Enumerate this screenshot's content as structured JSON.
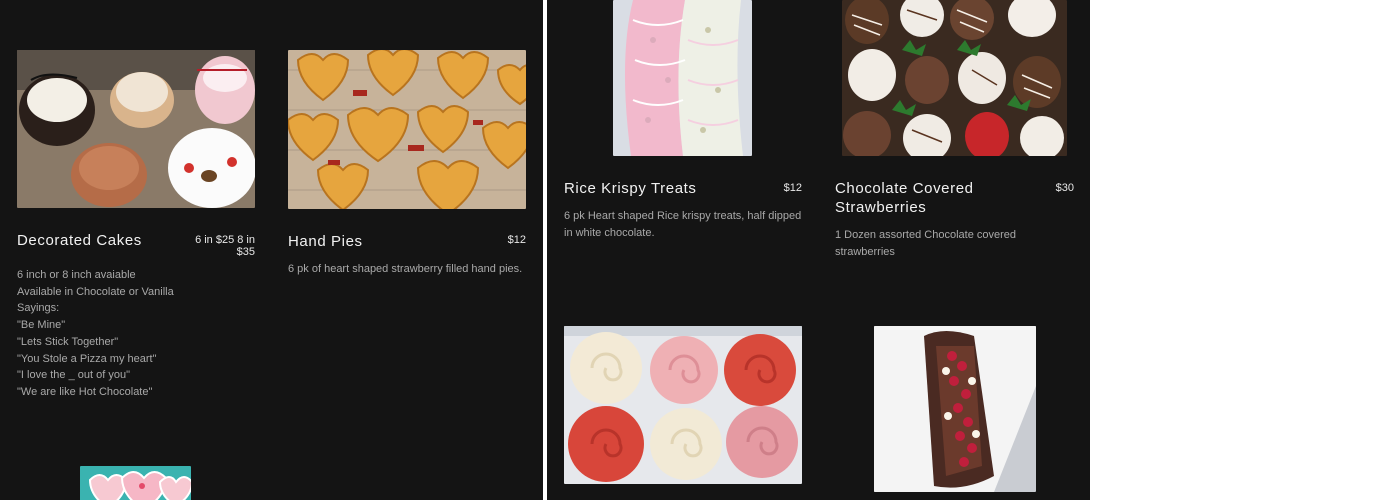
{
  "left_panel": {
    "items": [
      {
        "name": "Decorated Cakes",
        "price": "6 in $25 8 in $35",
        "description": "6 inch or 8 inch avaiable\nAvailable in Chocolate or Vanilla\nSayings:\n\"Be Mine\"\n\"Lets Stick Together\"\n\"You Stole  a Pizza my heart\"\n\"I love the _ out of you\"\n\"We are like Hot Chocolate\""
      },
      {
        "name": "Hand Pies",
        "price": "$12",
        "description": "6 pk of heart shaped strawberry filled hand pies."
      }
    ]
  },
  "right_panel": {
    "items": [
      {
        "name": "Rice Krispy Treats",
        "price": "$12",
        "description": "6 pk Heart shaped Rice krispy treats, half dipped in white chocolate."
      },
      {
        "name": "Chocolate Covered Strawberries",
        "price": "$30",
        "description": "1 Dozen assorted Chocolate covered strawberries"
      }
    ]
  },
  "colors": {
    "panel_background": "#141414",
    "title_text": "#f1f1f1",
    "description_text": "#a9a9a9"
  }
}
